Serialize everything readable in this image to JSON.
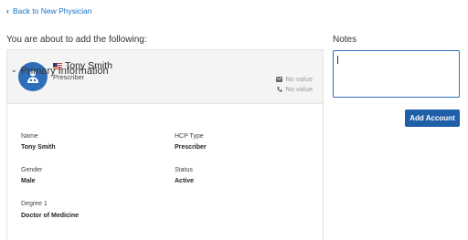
{
  "nav": {
    "back_label": "Back to New Physician"
  },
  "intro": {
    "text": "You are about to add the following:"
  },
  "profile": {
    "name": "Tony Smith",
    "role": "Prescriber",
    "email": "No value",
    "phone": "No value",
    "flag": "us-flag-icon",
    "avatar_icon": "physician-icon"
  },
  "section": {
    "title": "Primary Information",
    "fields": [
      {
        "label": "Name",
        "value": "Tony Smith"
      },
      {
        "label": "HCP Type",
        "value": "Prescriber"
      },
      {
        "label": "Gender",
        "value": "Male"
      },
      {
        "label": "Status",
        "value": "Active"
      },
      {
        "label": "Degree 1",
        "value": "Doctor of Medicine"
      }
    ]
  },
  "notes": {
    "label": "Notes",
    "value": ""
  },
  "actions": {
    "add_account_label": "Add Account"
  },
  "colors": {
    "accent": "#1f5fa8",
    "link": "#1a73c8",
    "avatar": "#2f6fba"
  }
}
